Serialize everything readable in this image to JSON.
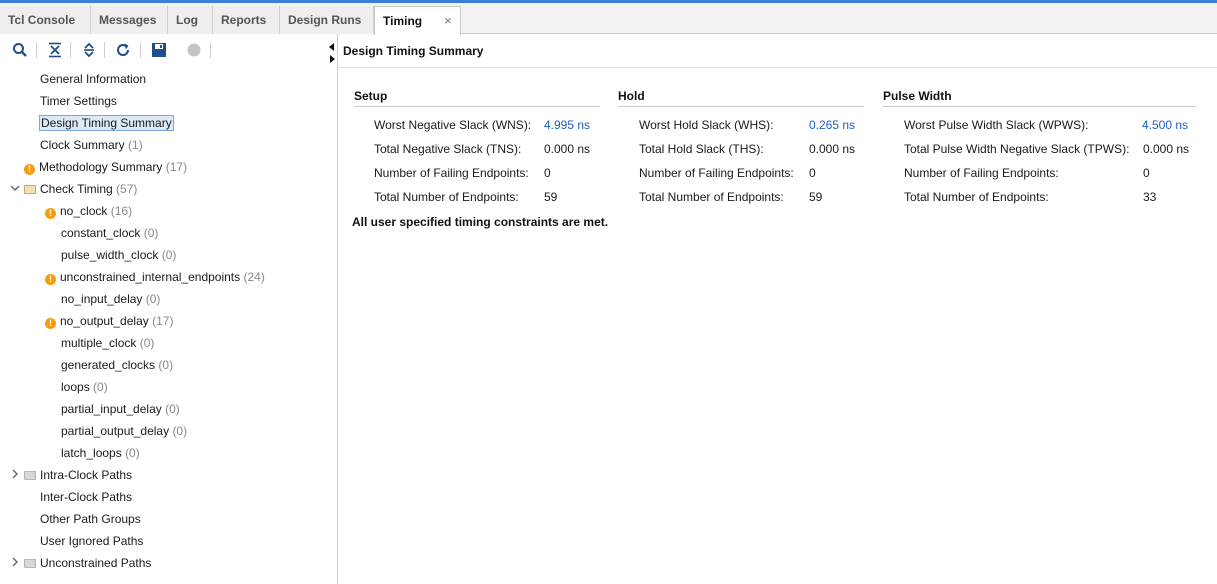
{
  "tabs": [
    {
      "label": "Tcl Console"
    },
    {
      "label": "Messages"
    },
    {
      "label": "Log"
    },
    {
      "label": "Reports"
    },
    {
      "label": "Design Runs"
    },
    {
      "label": "Timing",
      "close": "×"
    }
  ],
  "toolbar": {
    "icons": [
      "search-icon",
      "collapse-all-icon",
      "expand-all-icon",
      "refresh-icon",
      "save-icon",
      "stop-icon"
    ]
  },
  "tree": {
    "general_information": "General Information",
    "timer_settings": "Timer Settings",
    "design_timing_summary": "Design Timing Summary",
    "clock_summary": "Clock Summary",
    "clock_summary_count": "(1)",
    "methodology_summary": "Methodology Summary",
    "methodology_summary_count": "(17)",
    "check_timing": "Check Timing",
    "check_timing_count": "(57)",
    "checks": [
      {
        "label": "no_clock",
        "count": "(16)",
        "warn": true
      },
      {
        "label": "constant_clock",
        "count": "(0)",
        "warn": false
      },
      {
        "label": "pulse_width_clock",
        "count": "(0)",
        "warn": false
      },
      {
        "label": "unconstrained_internal_endpoints",
        "count": "(24)",
        "warn": true
      },
      {
        "label": "no_input_delay",
        "count": "(0)",
        "warn": false
      },
      {
        "label": "no_output_delay",
        "count": "(17)",
        "warn": true
      },
      {
        "label": "multiple_clock",
        "count": "(0)",
        "warn": false
      },
      {
        "label": "generated_clocks",
        "count": "(0)",
        "warn": false
      },
      {
        "label": "loops",
        "count": "(0)",
        "warn": false
      },
      {
        "label": "partial_input_delay",
        "count": "(0)",
        "warn": false
      },
      {
        "label": "partial_output_delay",
        "count": "(0)",
        "warn": false
      },
      {
        "label": "latch_loops",
        "count": "(0)",
        "warn": false
      }
    ],
    "intra_clock_paths": "Intra-Clock Paths",
    "inter_clock_paths": "Inter-Clock Paths",
    "other_path_groups": "Other Path Groups",
    "user_ignored_paths": "User Ignored Paths",
    "unconstrained_paths": "Unconstrained Paths"
  },
  "summary": {
    "title": "Design Timing Summary",
    "setup": {
      "heading": "Setup",
      "rows": [
        {
          "label": "Worst Negative Slack (WNS):",
          "value": "4.995 ns",
          "link": true
        },
        {
          "label": "Total Negative Slack (TNS):",
          "value": "0.000 ns",
          "link": false
        },
        {
          "label": "Number of Failing Endpoints:",
          "value": "0",
          "link": false
        },
        {
          "label": "Total Number of Endpoints:",
          "value": "59",
          "link": false
        }
      ]
    },
    "hold": {
      "heading": "Hold",
      "rows": [
        {
          "label": "Worst Hold Slack (WHS):",
          "value": "0.265 ns",
          "link": true
        },
        {
          "label": "Total Hold Slack (THS):",
          "value": "0.000 ns",
          "link": false
        },
        {
          "label": "Number of Failing Endpoints:",
          "value": "0",
          "link": false
        },
        {
          "label": "Total Number of Endpoints:",
          "value": "59",
          "link": false
        }
      ]
    },
    "pulse_width": {
      "heading": "Pulse Width",
      "rows": [
        {
          "label": "Worst Pulse Width Slack (WPWS):",
          "value": "4.500 ns",
          "link": true
        },
        {
          "label": "Total Pulse Width Negative Slack (TPWS):",
          "value": "0.000 ns",
          "link": false
        },
        {
          "label": "Number of Failing Endpoints:",
          "value": "0",
          "link": false
        },
        {
          "label": "Total Number of Endpoints:",
          "value": "33",
          "link": false
        }
      ]
    },
    "constraints_message": "All user specified timing constraints are met."
  },
  "colors": {
    "accent": "#3b7fd4",
    "link": "#1c5fc2",
    "warning": "#f39c12",
    "selection": "#dce9f7"
  }
}
